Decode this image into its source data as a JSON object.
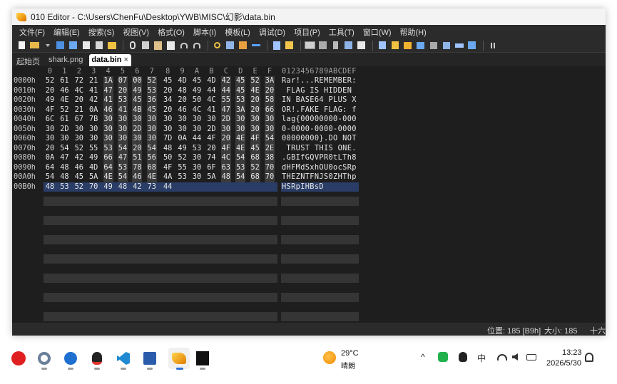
{
  "window": {
    "title": "010 Editor - C:\\Users\\ChenFu\\Desktop\\YWB\\MISC\\幻影\\data.bin"
  },
  "menu": [
    "文件(F)",
    "编辑(E)",
    "搜索(S)",
    "视图(V)",
    "格式(O)",
    "脚本(I)",
    "模板(L)",
    "调试(D)",
    "项目(P)",
    "工具(T)",
    "窗口(W)",
    "帮助(H)"
  ],
  "toolbar": {
    "icons": [
      "new-file-icon",
      "open-folder-icon",
      "save-icon",
      "save-all-icon",
      "close-file-icon",
      "copy-file-icon",
      "folder-icon",
      "cut-icon",
      "copy-icon",
      "paste-icon",
      "paste-special-icon",
      "undo-icon",
      "redo-icon",
      "find-icon",
      "find-replace-icon",
      "goto-icon",
      "bookmark-icon",
      "compare-icon",
      "hex-mode-icon",
      "fold-icon",
      "paragraph-icon",
      "columns-icon",
      "highlight-icon",
      "calculator-icon",
      "template-icon",
      "script-icon",
      "inspector-icon",
      "percent-icon",
      "check-icon",
      "mov-icon",
      "convert-icon",
      "pause-icon"
    ]
  },
  "tabs": [
    {
      "label": "起始页",
      "active": false
    },
    {
      "label": "shark.png",
      "active": false
    },
    {
      "label": "data.bin",
      "active": true,
      "close": "×"
    }
  ],
  "hex_view": {
    "column_headers": [
      "0",
      "1",
      "2",
      "3",
      "4",
      "5",
      "6",
      "7",
      "8",
      "9",
      "A",
      "B",
      "C",
      "D",
      "E",
      "F"
    ],
    "ascii_header": "0123456789ABCDEF",
    "rows": [
      {
        "offset": "0000h",
        "bytes": [
          "52",
          "61",
          "72",
          "21",
          "1A",
          "07",
          "00",
          "52",
          "45",
          "4D",
          "45",
          "4D",
          "42",
          "45",
          "52",
          "3A"
        ],
        "ascii": "Rar!...REMEMBER:"
      },
      {
        "offset": "0010h",
        "bytes": [
          "20",
          "46",
          "4C",
          "41",
          "47",
          "20",
          "49",
          "53",
          "20",
          "48",
          "49",
          "44",
          "44",
          "45",
          "4E",
          "20"
        ],
        "ascii": " FLAG IS HIDDEN "
      },
      {
        "offset": "0020h",
        "bytes": [
          "49",
          "4E",
          "20",
          "42",
          "41",
          "53",
          "45",
          "36",
          "34",
          "20",
          "50",
          "4C",
          "55",
          "53",
          "20",
          "58"
        ],
        "ascii": "IN BASE64 PLUS X"
      },
      {
        "offset": "0030h",
        "bytes": [
          "4F",
          "52",
          "21",
          "0A",
          "46",
          "41",
          "4B",
          "45",
          "20",
          "46",
          "4C",
          "41",
          "47",
          "3A",
          "20",
          "66"
        ],
        "ascii": "OR!.FAKE FLAG: f"
      },
      {
        "offset": "0040h",
        "bytes": [
          "6C",
          "61",
          "67",
          "7B",
          "30",
          "30",
          "30",
          "30",
          "30",
          "30",
          "30",
          "30",
          "2D",
          "30",
          "30",
          "30"
        ],
        "ascii": "lag{00000000-000"
      },
      {
        "offset": "0050h",
        "bytes": [
          "30",
          "2D",
          "30",
          "30",
          "30",
          "30",
          "2D",
          "30",
          "30",
          "30",
          "30",
          "2D",
          "30",
          "30",
          "30",
          "30"
        ],
        "ascii": "0-0000-0000-0000"
      },
      {
        "offset": "0060h",
        "bytes": [
          "30",
          "30",
          "30",
          "30",
          "30",
          "30",
          "30",
          "30",
          "7D",
          "0A",
          "44",
          "4F",
          "20",
          "4E",
          "4F",
          "54"
        ],
        "ascii": "00000000}.DO NOT"
      },
      {
        "offset": "0070h",
        "bytes": [
          "20",
          "54",
          "52",
          "55",
          "53",
          "54",
          "20",
          "54",
          "48",
          "49",
          "53",
          "20",
          "4F",
          "4E",
          "45",
          "2E"
        ],
        "ascii": " TRUST THIS ONE."
      },
      {
        "offset": "0080h",
        "bytes": [
          "0A",
          "47",
          "42",
          "49",
          "66",
          "47",
          "51",
          "56",
          "50",
          "52",
          "30",
          "74",
          "4C",
          "54",
          "68",
          "38"
        ],
        "ascii": ".GBIfGQVPR0tLTh8"
      },
      {
        "offset": "0090h",
        "bytes": [
          "64",
          "48",
          "46",
          "4D",
          "64",
          "53",
          "78",
          "68",
          "4F",
          "55",
          "30",
          "6F",
          "63",
          "53",
          "52",
          "70"
        ],
        "ascii": "dHFMdSxhOU0ocSRp"
      },
      {
        "offset": "00A0h",
        "bytes": [
          "54",
          "48",
          "45",
          "5A",
          "4E",
          "54",
          "46",
          "4E",
          "4A",
          "53",
          "30",
          "5A",
          "48",
          "54",
          "68",
          "70"
        ],
        "ascii": "THEZNTFNJS0ZHThp"
      },
      {
        "offset": "00B0h",
        "bytes": [
          "48",
          "53",
          "52",
          "70",
          "49",
          "48",
          "42",
          "73",
          "44"
        ],
        "ascii": "HSRpIHBsD",
        "selected": true
      }
    ]
  },
  "status": {
    "position": "位置: 185 [B9h]",
    "size": "大小: 185",
    "encoding": "十六"
  },
  "taskbar": {
    "apps": [
      "netease-music-icon",
      "settings-gear-icon",
      "feather-app-icon",
      "qq-penguin-icon",
      "vscode-icon",
      "word-icon",
      "010-editor-icon",
      "bc-app-icon"
    ],
    "weather": {
      "temp": "29°C",
      "desc": "晴朗"
    },
    "tray": {
      "caret": "^",
      "wechat": "wechat-icon",
      "qq": "qq-icon",
      "ime": "中",
      "wifi": "wifi-icon",
      "volume": "volume-icon",
      "battery": "battery-icon"
    },
    "clock": {
      "time": "13:23",
      "date": "2026/5/30"
    },
    "notification": "notification-icon"
  },
  "colors": {
    "editor_bg": "#1e1e1e",
    "band_bg": "#3b3b3b",
    "selection_bg": "#2a3d66",
    "active_tab_bg": "#ffffff"
  }
}
